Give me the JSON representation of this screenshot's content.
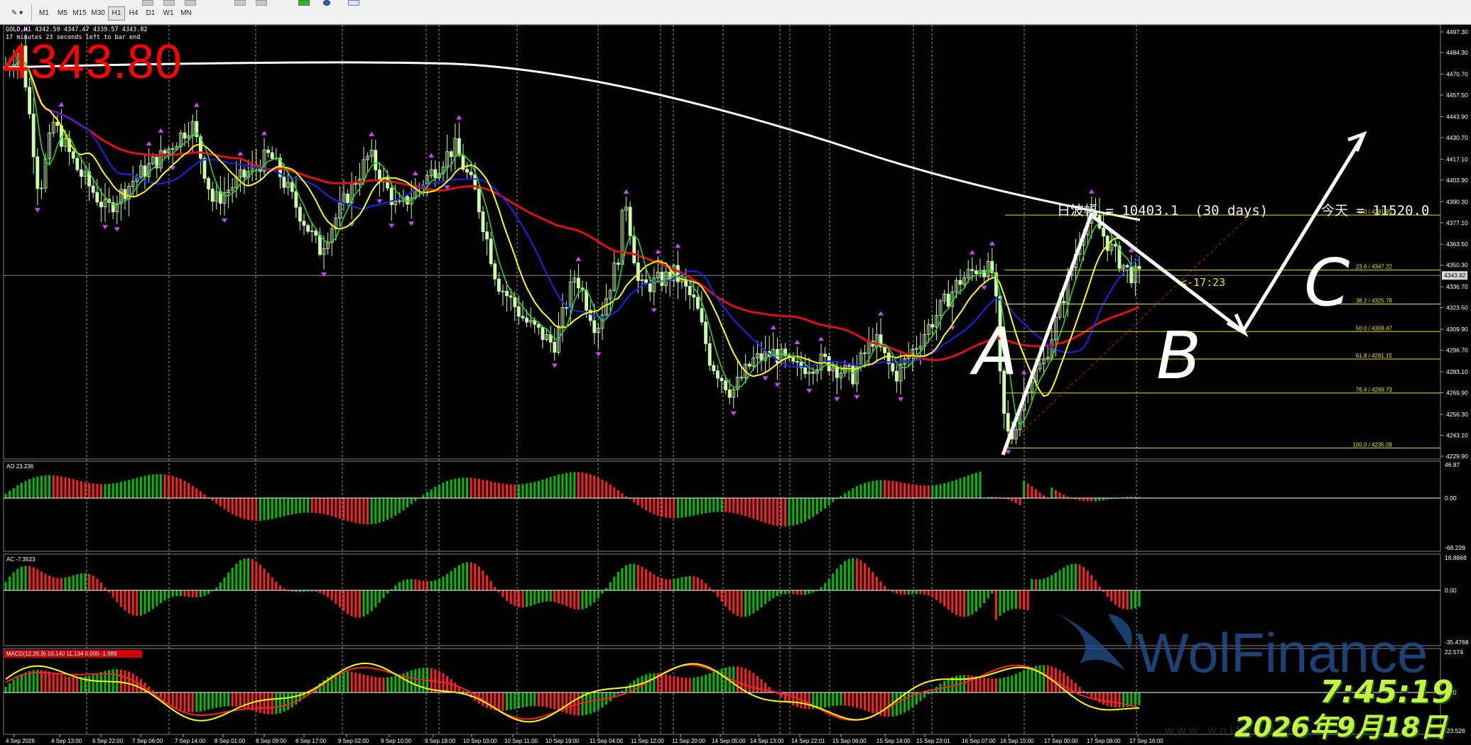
{
  "toolbar": {
    "timeframes": [
      "M1",
      "M5",
      "M15",
      "M30",
      "H1",
      "H4",
      "D1",
      "W1",
      "MN"
    ],
    "active_timeframe": "H1"
  },
  "chart": {
    "symbol_info": "GOLD,H1  4342.59 4347.47 4339.57 4343.82",
    "timer_info": "17 minutes 23 seconds left to bar end",
    "big_price": "4343.80",
    "daily_range_text": "日波幅 = 10403.1  (30 days)",
    "today_text": "今天 = 11520.0",
    "countdown": "<-17:23",
    "current_price_label": "4343.82",
    "wave_labels": [
      "A",
      "B",
      "C"
    ],
    "price_axis": [
      "4497.30",
      "4484.30",
      "4470.70",
      "4457.50",
      "4443.90",
      "4430.70",
      "4417.10",
      "4403.90",
      "4390.30",
      "4377.10",
      "4363.50",
      "4350.30",
      "4336.70",
      "4323.50",
      "4309.90",
      "4296.70",
      "4283.10",
      "4269.90",
      "4256.30",
      "4243.10",
      "4229.90"
    ],
    "time_axis": [
      "4 Sep 2026",
      "4 Sep 13:00",
      "6 Sep 22:00",
      "7 Sep 06:00",
      "7 Sep 14:00",
      "8 Sep 01:00",
      "8 Sep 09:00",
      "8 Sep 17:00",
      "9 Sep 02:00",
      "9 Sep 10:00",
      "9 Sep 18:00",
      "10 Sep 03:00",
      "10 Sep 11:00",
      "10 Sep 19:00",
      "11 Sep 04:00",
      "11 Sep 12:00",
      "11 Sep 20:00",
      "14 Sep 05:00",
      "14 Sep 13:00",
      "14 Sep 22:01",
      "15 Sep 06:00",
      "15 Sep 14:00",
      "15 Sep 23:01",
      "16 Sep 07:00",
      "16 Sep 15:00",
      "17 Sep 00:00",
      "17 Sep 08:00",
      "17 Sep 16:00"
    ],
    "fib_levels": [
      {
        "label": "0.0 / 4381.85",
        "value": 4381.85
      },
      {
        "label": "23.6 / 4347.22",
        "value": 4347.22
      },
      {
        "label": "38.2 / 4325.79",
        "value": 4325.79
      },
      {
        "label": "50.0 / 4308.47",
        "value": 4308.47
      },
      {
        "label": "61.8 / 4291.15",
        "value": 4291.15
      },
      {
        "label": "76.4 / 4269.73",
        "value": 4269.73
      },
      {
        "label": "100.0 / 4235.09",
        "value": 4235.09
      }
    ]
  },
  "ao": {
    "label": "AO 23.236",
    "scale_top": "46.87",
    "scale_zero": "0.00",
    "scale_bottom": "-68.228"
  },
  "ac": {
    "label": "AC -7.3523",
    "scale_top": "18.8868",
    "scale_zero": "0.00",
    "scale_bottom": "-35.4768"
  },
  "macd": {
    "label": "MACD(12,26,9) 10.140 11.134 0.000 -1.989",
    "scale_top": "22.574",
    "scale_zero": "0.00",
    "scale_bottom": "-23.526"
  },
  "watermark": {
    "brand": "WolFinance",
    "url": "w w w . w o l f i n a n c e"
  },
  "clock": {
    "time": "7:45:19",
    "date": "2026年9月18日"
  },
  "colors": {
    "bull": "#ccffaa",
    "bear": "#ccffaa",
    "ma_red": "#e01010",
    "ma_white": "#ffffff",
    "ma_yellow": "#ffff00",
    "ma_blue": "#2020ee",
    "ma_green": "#20e020",
    "fib": "#e6e600",
    "price_big": "#ff0000",
    "histo_up": "#00c000",
    "histo_down": "#ff2020"
  }
}
